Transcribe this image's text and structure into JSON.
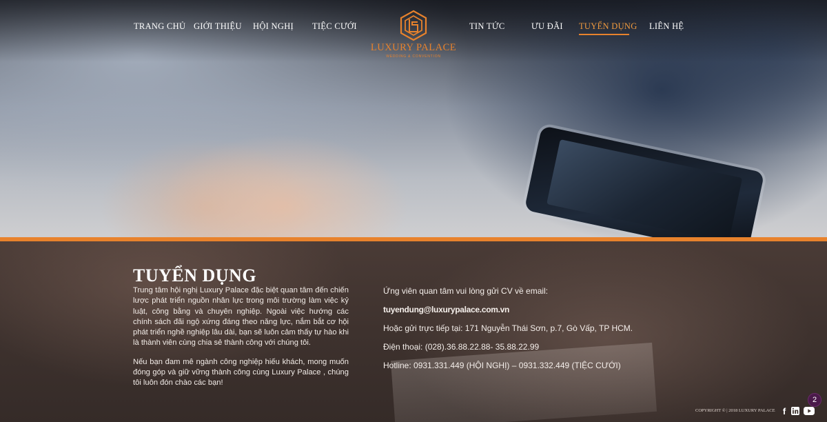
{
  "nav": {
    "left": [
      {
        "label": "TRANG CHỦ"
      },
      {
        "label": "GIỚI THIỆU"
      },
      {
        "label": "HỘI NGHỊ"
      },
      {
        "label": "TIỆC CƯỚI"
      }
    ],
    "right": [
      {
        "label": "TIN TỨC"
      },
      {
        "label": "ƯU ĐÃI"
      },
      {
        "label": "TUYỂN DỤNG",
        "active": true
      },
      {
        "label": "LIÊN HỆ"
      }
    ]
  },
  "logo": {
    "name": "LUXURY PALACE",
    "subtitle": "WEDDING & CONVENTION"
  },
  "content": {
    "title": "TUYỂN DỤNG",
    "paragraph1": "Trung tâm hội nghị Luxury Palace đặc biệt quan tâm đến chiến lược phát triển nguồn nhân lực trong môi trường làm việc kỷ luật, công bằng và chuyên nghiệp. Ngoài việc hướng các chính sách đãi ngộ xứng đáng theo năng lực, nắm bắt cơ hội phát triển nghề nghiệp lâu dài, bạn sẽ luôn cảm thấy tự hào khi là thành viên cùng chia sẻ thành công với chúng tôi.",
    "paragraph2": "Nếu bạn đam mê ngành công nghiệp hiếu khách, mong muốn đóng góp và giữ vững thành công cùng Luxury Palace , chúng tôi luôn đón chào các bạn!",
    "contact_intro": "Ứng viên quan tâm vui lòng gửi CV về email:",
    "email": "tuyendung@luxurypalace.com.vn",
    "address": "Hoặc gửi trực tiếp tại: 171 Nguyễn Thái Sơn, p.7, Gò Vấp, TP HCM.",
    "phone": "Điện thoại: (028).36.88.22.88- 35.88.22.99",
    "hotline": "Hotline: 0931.331.449 (HỘI NGHỊ) – 0931.332.449 (TIỆC CƯỚI)"
  },
  "footer": {
    "copyright": "COPYRIGHT © | 2018 LUXURY PALACE",
    "social": [
      "facebook-icon",
      "linkedin-icon",
      "youtube-icon"
    ],
    "badge_count": "2"
  },
  "colors": {
    "accent": "#e8822c",
    "bottom_bg": "#3e322e"
  }
}
